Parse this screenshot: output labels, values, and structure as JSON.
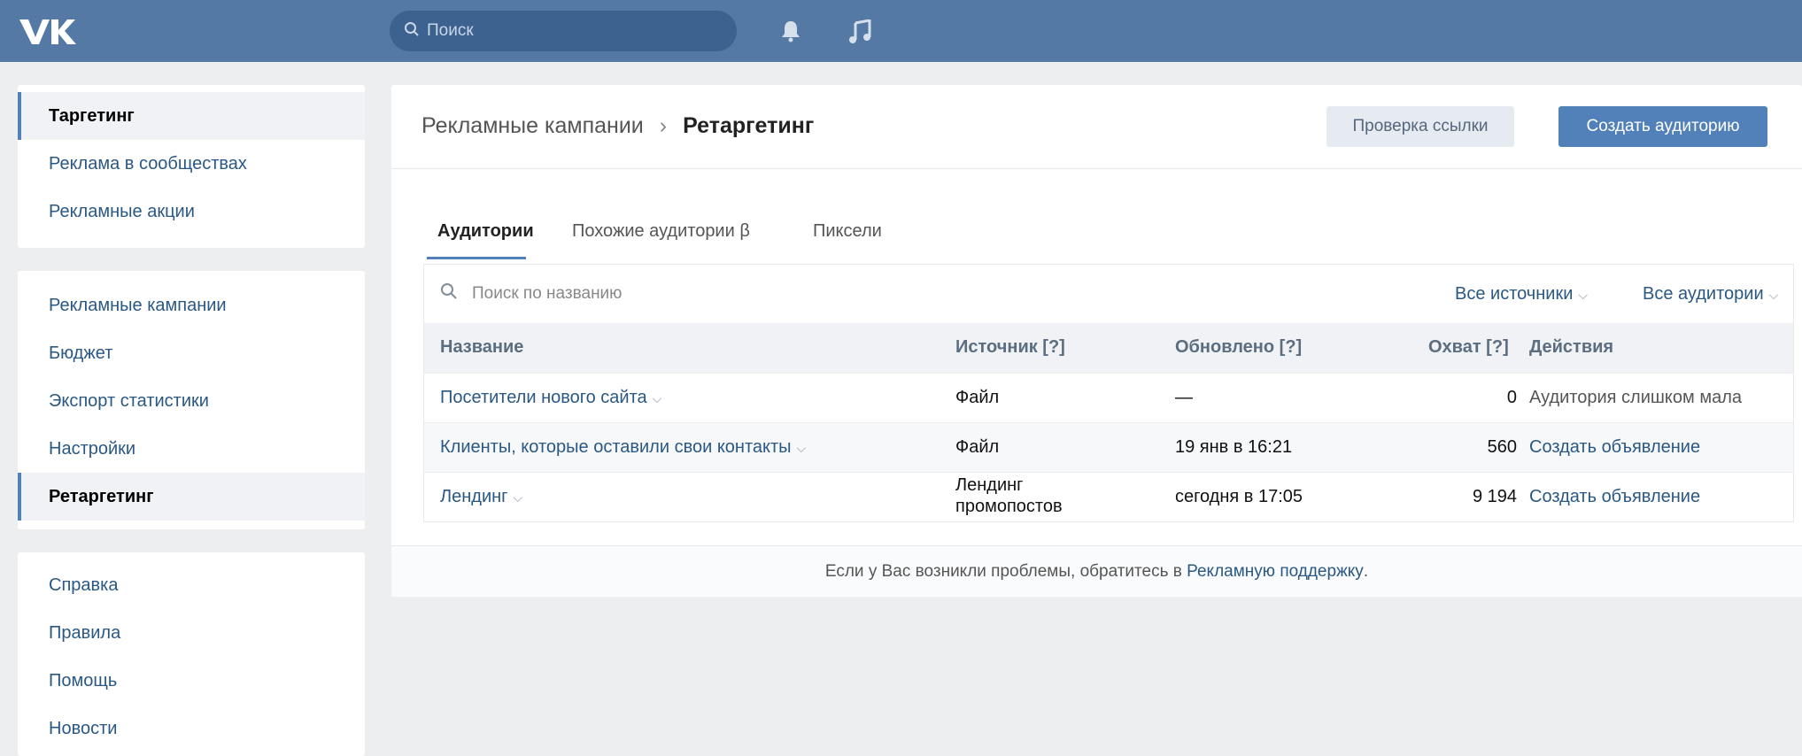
{
  "header": {
    "logo_text": "VK",
    "search_placeholder": "Поиск"
  },
  "icons": {
    "logo": "vk-logo-icon",
    "search": "search-icon",
    "notifications": "bell-icon",
    "music": "music-note-icon",
    "table_search": "search-icon",
    "dropdown": "chevron-down-icon"
  },
  "sidebar": {
    "group1": [
      {
        "label": "Таргетинг"
      },
      {
        "label": "Реклама в сообществах"
      },
      {
        "label": "Рекламные акции"
      }
    ],
    "group2": [
      {
        "label": "Рекламные кампании"
      },
      {
        "label": "Бюджет"
      },
      {
        "label": "Экспорт статистики"
      },
      {
        "label": "Настройки"
      },
      {
        "label": "Ретаргетинг"
      }
    ],
    "group3": [
      {
        "label": "Справка"
      },
      {
        "label": "Правила"
      },
      {
        "label": "Помощь"
      },
      {
        "label": "Новости"
      }
    ]
  },
  "main": {
    "breadcrumb_parent": "Рекламные кампании",
    "breadcrumb_sep": "›",
    "breadcrumb_current": "Ретаргетинг",
    "btn_check": "Проверка ссылки",
    "btn_create": "Создать аудиторию",
    "tabs": [
      {
        "label": "Аудитории"
      },
      {
        "label": "Похожие аудитории β"
      },
      {
        "label": "Пиксели"
      }
    ],
    "search_placeholder": "Поиск по названию",
    "filter_sources": "Все источники",
    "filter_audiences": "Все аудитории",
    "columns": {
      "name": "Название",
      "source": "Источник [?]",
      "updated": "Обновлено [?]",
      "reach": "Охват [?]",
      "actions": "Действия"
    },
    "rows": [
      {
        "name": "Посетители нового сайта",
        "source": "Файл",
        "updated": "—",
        "reach": "0",
        "action": "Аудитория слишком мала"
      },
      {
        "name": "Клиенты, которые оставили свои контакты",
        "source": "Файл",
        "updated": "19 янв в 16:21",
        "reach": "560",
        "action": "Создать объявление"
      },
      {
        "name": "Лендинг",
        "source_line1": "Лендинг",
        "source_line2": "промопостов",
        "updated": "сегодня в 17:05",
        "reach": "9 194",
        "action": "Создать объявление"
      }
    ],
    "footer_text": "Если у Вас возникли проблемы, обратитесь в ",
    "footer_link": "Рекламную поддержку",
    "footer_end": "."
  },
  "colors": {
    "header": "#5479a4",
    "accent": "#5181b8",
    "link": "#2a5885",
    "background": "#edeef0"
  }
}
